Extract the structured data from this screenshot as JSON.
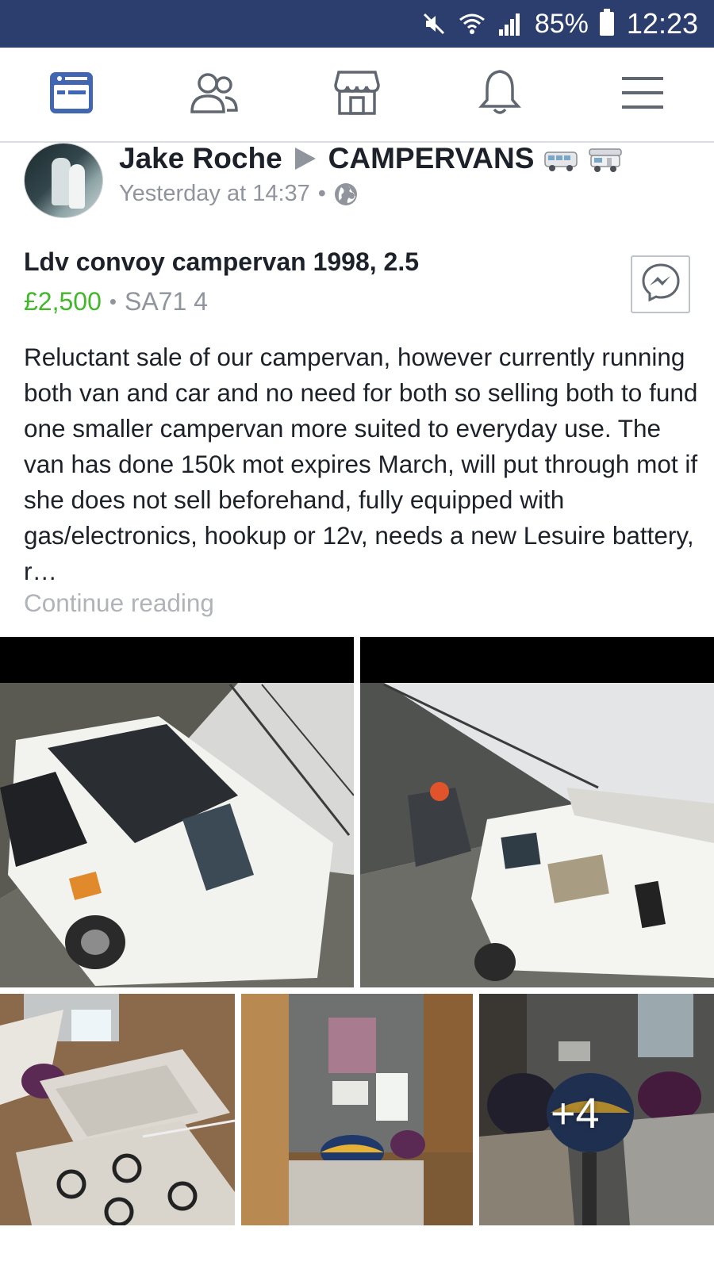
{
  "status_bar": {
    "battery": "85%",
    "time": "12:23",
    "mute_icon": "mute-icon",
    "wifi_icon": "wifi-icon",
    "signal_icon": "signal-icon"
  },
  "nav": {
    "items": [
      {
        "name": "news-feed",
        "icon": "news-feed-icon",
        "active": true
      },
      {
        "name": "friends",
        "icon": "friends-icon",
        "active": false
      },
      {
        "name": "marketplace",
        "icon": "marketplace-icon",
        "active": false
      },
      {
        "name": "notifications",
        "icon": "bell-icon",
        "active": false
      },
      {
        "name": "menu",
        "icon": "hamburger-menu-icon",
        "active": false
      }
    ],
    "active_color": "#4267b2"
  },
  "post": {
    "author": "Jake Roche",
    "group": "CAMPERVANS",
    "timestamp": "Yesterday at 14:37",
    "separator": "•",
    "privacy_icon": "globe-icon"
  },
  "listing": {
    "title": "Ldv convoy campervan 1998, 2.5",
    "price": "£2,500",
    "separator": "•",
    "location": "SA71 4",
    "description": "Reluctant sale of our campervan, however currently running both van and car and no need for both so selling both to fund one smaller campervan more suited to everyday use. The van has done  150k mot expires March, will put through mot if she does not sell beforehand, fully equipped with gas/electronics, hookup or 12v, needs a new Lesuire battery, r…",
    "continue_reading": "Continue reading",
    "price_color": "#42b72a"
  },
  "photos": {
    "more_count": "+4"
  }
}
